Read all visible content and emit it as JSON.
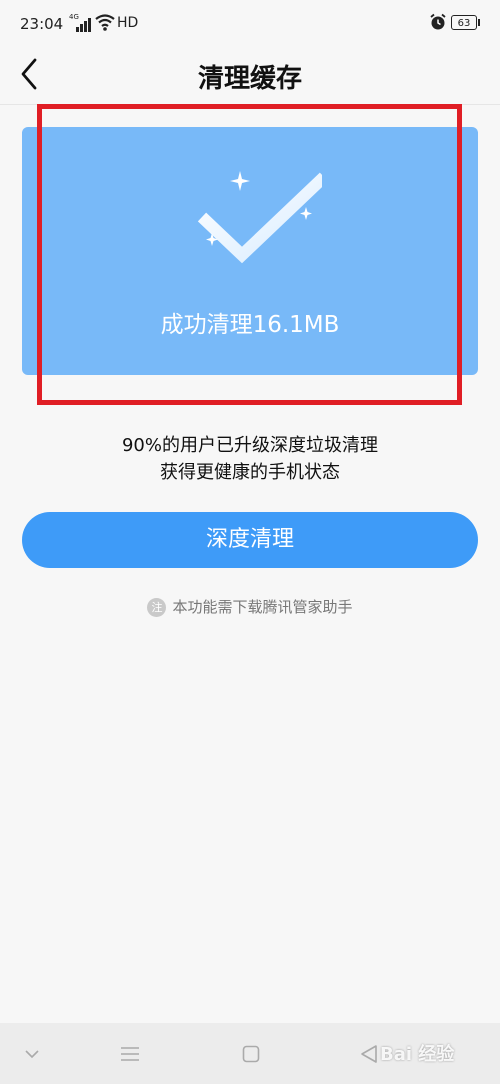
{
  "status_bar": {
    "time": "23:04",
    "network_label": "4G",
    "hd_label": "HD",
    "battery": "63",
    "icons": [
      "signal-icon",
      "wifi-icon",
      "alarm-icon",
      "battery-icon"
    ]
  },
  "header": {
    "title": "清理缓存",
    "back_icon": "chevron-left-icon"
  },
  "result": {
    "text": "成功清理16.1MB",
    "icon": "checkmark-sparkle-icon",
    "card_color": "#78b9f8"
  },
  "promo": {
    "line1": "90%的用户已升级深度垃圾清理",
    "line2": "获得更健康的手机状态"
  },
  "deep_clean_button": {
    "label": "深度清理",
    "color": "#3e9bf8"
  },
  "note": {
    "badge": "注",
    "text": "本功能需下载腾讯管家助手"
  },
  "highlight_color": "#e01e25",
  "watermark": "Bai 经验",
  "bottom_nav": [
    "chevron-down-icon",
    "menu-icon",
    "home-square-icon",
    "back-triangle-icon"
  ]
}
